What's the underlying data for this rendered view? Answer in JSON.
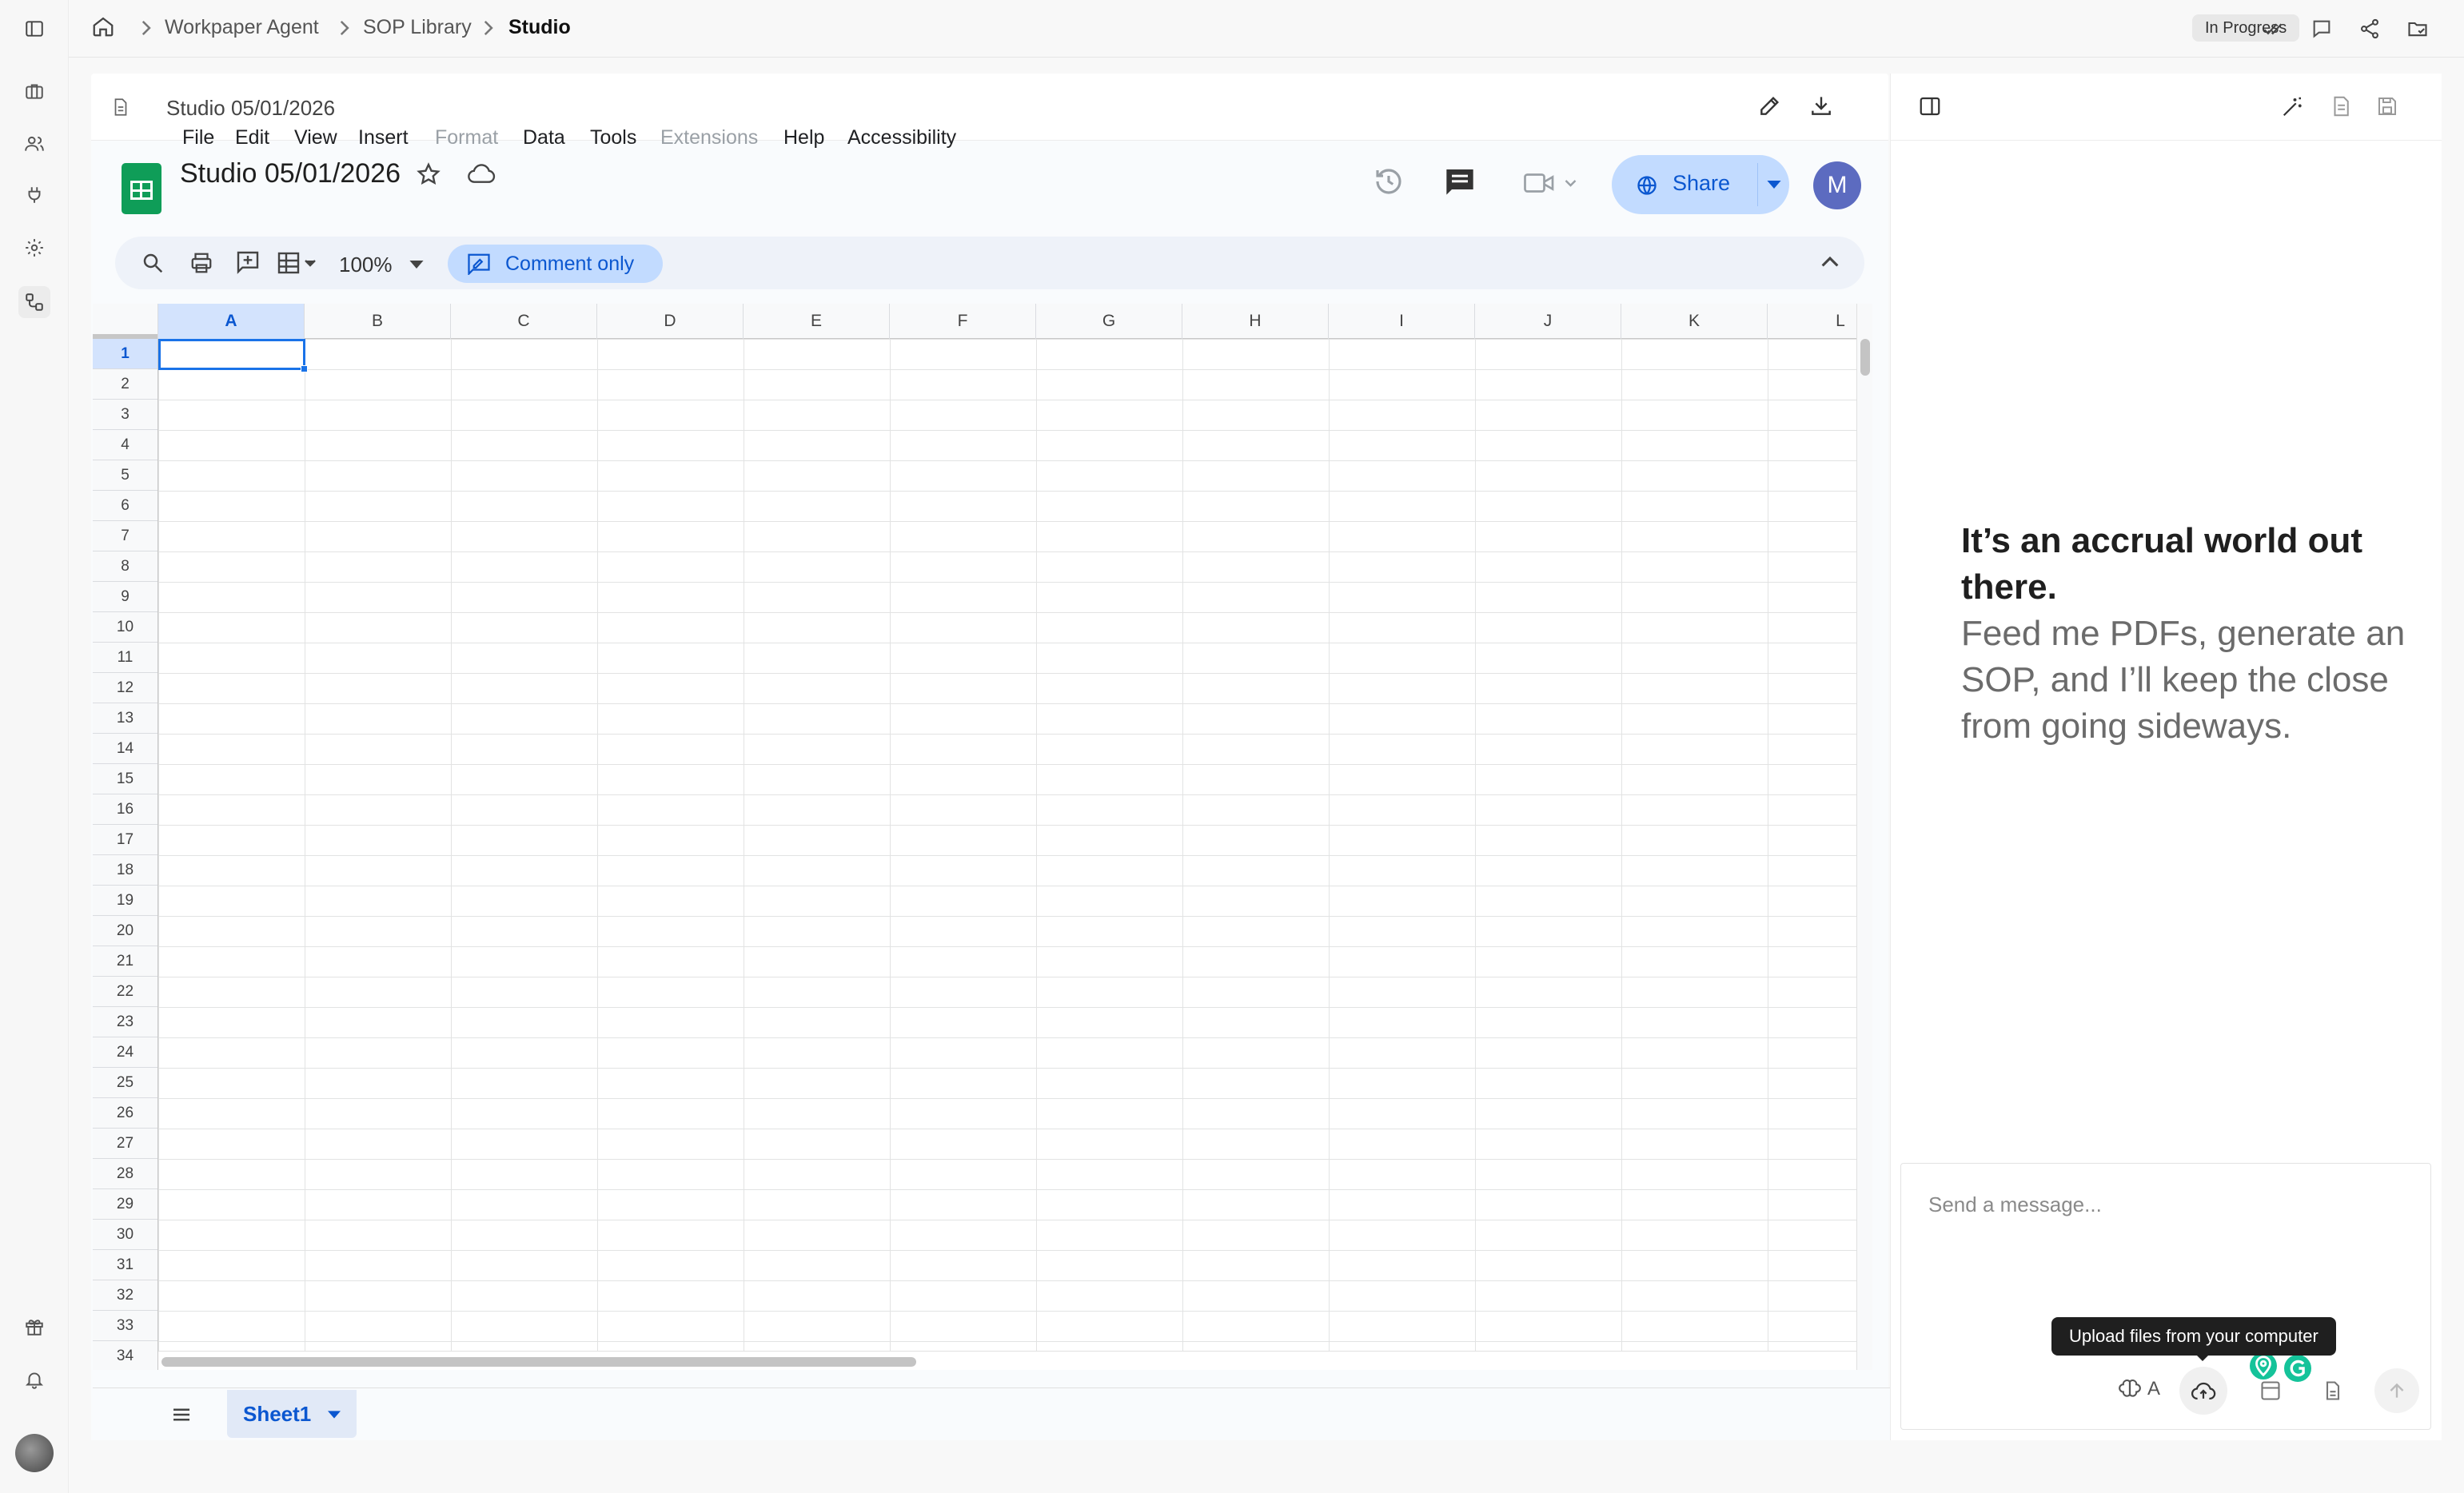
{
  "breadcrumb": {
    "items": [
      "Workpaper Agent",
      "SOP Library",
      "Studio"
    ]
  },
  "status": "In Progress",
  "document": {
    "header_title": "Studio 05/01/2026"
  },
  "sheets": {
    "title": "Studio 05/01/2026",
    "menu": [
      "File",
      "Edit",
      "View",
      "Insert",
      "Format",
      "Data",
      "Tools",
      "Extensions",
      "Help",
      "Accessibility"
    ],
    "disabled_menu": [
      "Format",
      "Extensions"
    ],
    "share_label": "Share",
    "avatar_initial": "M",
    "zoom": "100%",
    "mode_label": "Comment only",
    "columns": [
      "A",
      "B",
      "C",
      "D",
      "E",
      "F",
      "G",
      "H",
      "I",
      "J",
      "K",
      "L"
    ],
    "rows": [
      "1",
      "2",
      "3",
      "4",
      "5",
      "6",
      "7",
      "8",
      "9",
      "10",
      "11",
      "12",
      "13",
      "14",
      "15",
      "16",
      "17",
      "18",
      "19",
      "20",
      "21",
      "22",
      "23",
      "24",
      "25",
      "26",
      "27",
      "28",
      "29",
      "30",
      "31",
      "32",
      "33",
      "34"
    ],
    "selected_cell": "A1",
    "sheet_tab": "Sheet1"
  },
  "assistant": {
    "hero_title": "It’s an accrual world out there.",
    "hero_body": "Feed me PDFs, generate an SOP, and I’ll keep the close from going sideways.",
    "input_placeholder": "Send a message...",
    "model_label": "A",
    "tooltip": "Upload files from your computer"
  },
  "colors": {
    "accent_blue": "#0b57d0",
    "selection_blue": "#1a73e8",
    "sheets_green": "#0f9d58",
    "avatar_purple": "#5c6bc0",
    "grammarly_green": "#15c39a"
  }
}
